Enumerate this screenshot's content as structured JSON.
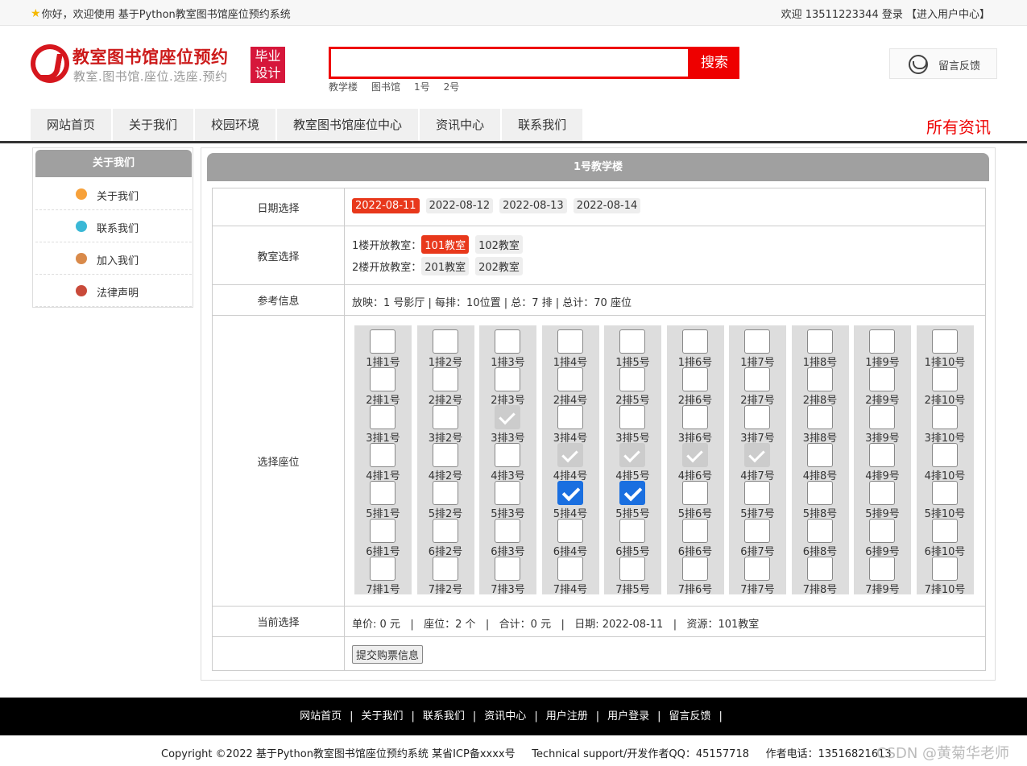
{
  "topbar": {
    "greeting": "你好，欢迎使用 基于Python教室图书馆座位预约系统",
    "user_text": "欢迎 13511223344 登录 【进入用户中心】"
  },
  "brand": {
    "title": "教室图书馆座位预约",
    "subtitle": "教室.图书馆.座位.选座.预约",
    "tag_line1": "毕业",
    "tag_line2": "设计"
  },
  "search": {
    "value": "",
    "button": "搜索",
    "hotwords": [
      "教学楼",
      "图书馆",
      "1号",
      "2号"
    ]
  },
  "feedback": {
    "label": "留言反馈"
  },
  "nav": {
    "items": [
      "网站首页",
      "关于我们",
      "校园环境",
      "教室图书馆座位中心",
      "资讯中心",
      "联系我们"
    ],
    "right": "所有资讯"
  },
  "sidebar": {
    "title": "关于我们",
    "items": [
      {
        "label": "关于我们",
        "color": "#f7a13a"
      },
      {
        "label": "联系我们",
        "color": "#3ab8d6"
      },
      {
        "label": "加入我们",
        "color": "#d98a4a"
      },
      {
        "label": "法律声明",
        "color": "#c94a3a"
      }
    ]
  },
  "main": {
    "title": "1号教学楼",
    "date_label": "日期选择",
    "dates": [
      "2022-08-11",
      "2022-08-12",
      "2022-08-13",
      "2022-08-14"
    ],
    "room_label": "教室选择",
    "floor1_label": "1楼开放教室：",
    "floor1_rooms": [
      "101教室",
      "102教室"
    ],
    "floor2_label": "2楼开放教室：",
    "floor2_rooms": [
      "201教室",
      "202教室"
    ],
    "info_label": "参考信息",
    "info_text": "放映：1 号影厅 | 每排：10位置 | 总：7 排 | 总计：70 座位",
    "seat_label": "选择座位",
    "current_label": "当前选择",
    "current_text": "单价: 0 元   |   座位：2 个   |   合计：0 元   |   日期: 2022-08-11   |   资源：101教室",
    "submit": "提交购票信息"
  },
  "seats": {
    "rows": 7,
    "cols": 10,
    "disabled": [
      "3-3",
      "4-4",
      "4-5",
      "4-6",
      "4-7"
    ],
    "checked": [
      "5-4",
      "5-5"
    ]
  },
  "footer": {
    "links": [
      "网站首页",
      "关于我们",
      "联系我们",
      "资讯中心",
      "用户注册",
      "用户登录",
      "留言反馈"
    ],
    "copyright": "Copyright ©2022 基于Python教室图书馆座位预约系统 某省ICP备xxxx号     Technical support/开发作者QQ：45157718     作者电话：13516821613",
    "watermark": "CSDN @黄菊华老师"
  }
}
